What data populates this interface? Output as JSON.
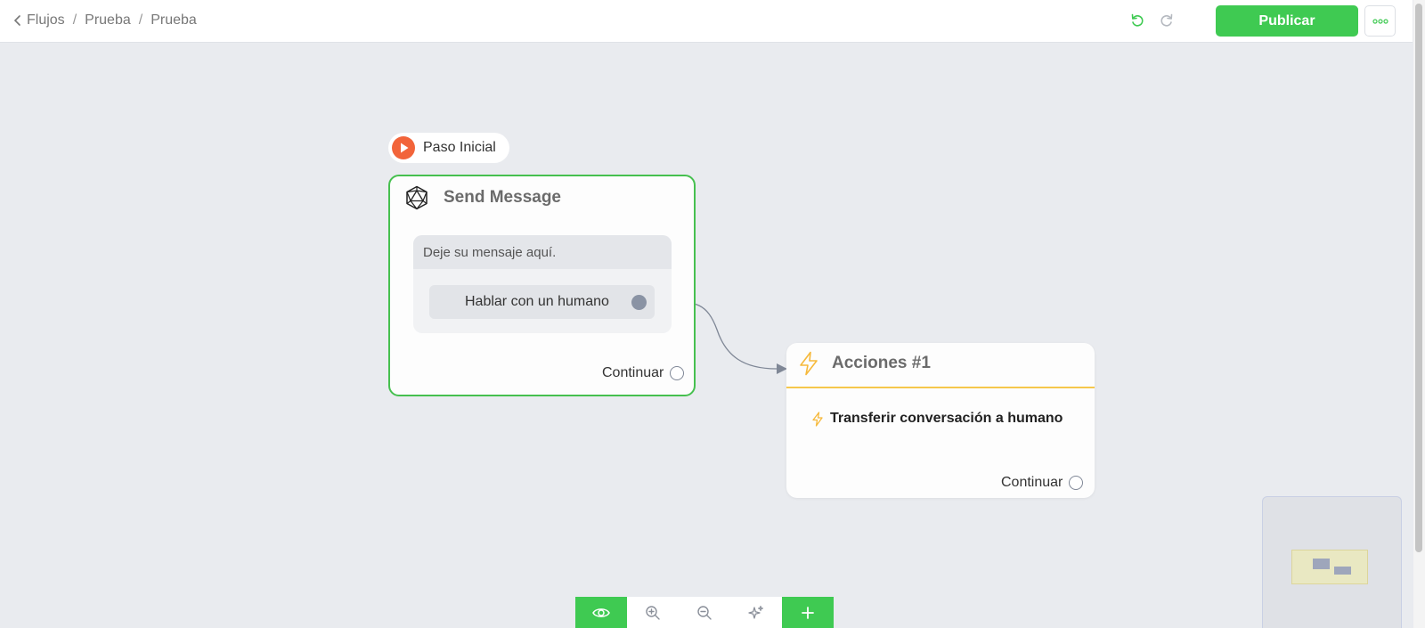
{
  "breadcrumb": {
    "items": [
      "Flujos",
      "Prueba",
      "Prueba"
    ],
    "separator": "/"
  },
  "header": {
    "publish_label": "Publicar"
  },
  "flow": {
    "start_label": "Paso Inicial",
    "send_message_node": {
      "title": "Send Message",
      "message_placeholder": "Deje su mensaje aquí.",
      "reply_button": "Hablar con un humano",
      "continue_label": "Continuar"
    },
    "actions_node": {
      "title": "Acciones #1",
      "action_label": "Transferir conversación a humano",
      "continue_label": "Continuar"
    }
  },
  "colors": {
    "primary_green": "#3fca52",
    "start_orange": "#f2643a",
    "action_yellow": "#f6c84c",
    "canvas_bg": "#e9ebef",
    "edge": "#7f8796"
  },
  "icons": {
    "back": "chevron-left-icon",
    "undo": "undo-icon",
    "redo": "redo-icon",
    "more": "more-dots-icon",
    "start": "play-icon",
    "send_message": "icosahedron-icon",
    "actions": "lightning-icon",
    "preview": "eye-icon",
    "zoom_in": "zoom-in-icon",
    "zoom_out": "zoom-out-icon",
    "auto_layout": "sparkles-icon",
    "add": "plus-icon"
  }
}
